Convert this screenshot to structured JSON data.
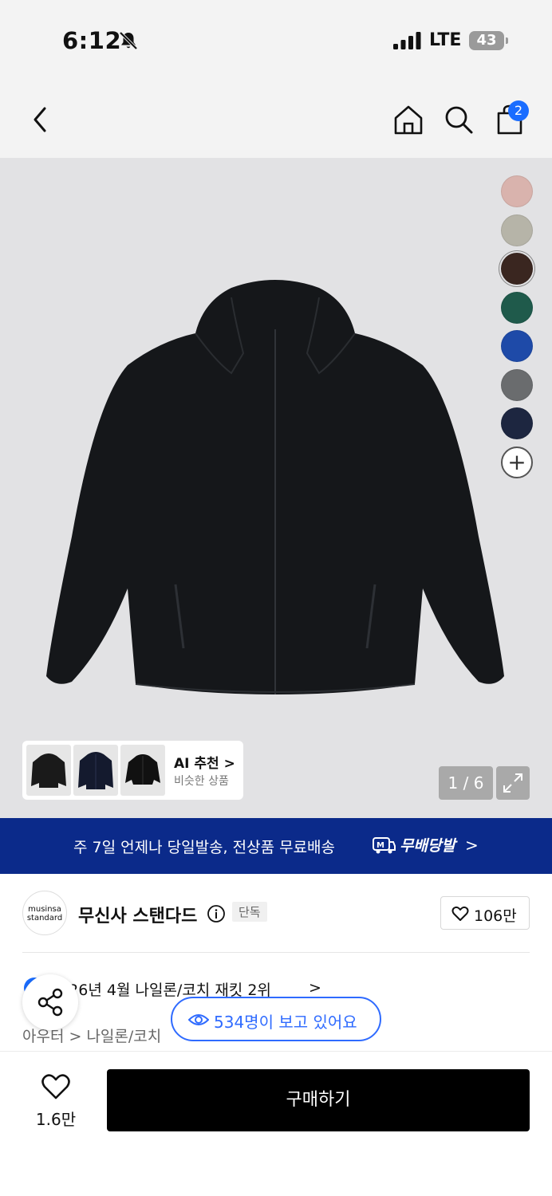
{
  "status_bar": {
    "time": "6:12",
    "network": "LTE",
    "battery": "43"
  },
  "nav": {
    "cart_count": "2"
  },
  "gallery": {
    "swatches": [
      "#d9b3ad",
      "#b6b4a8",
      "#3a2620",
      "#1f5a4b",
      "#1e4aa8",
      "#6a6c6e",
      "#1d2640"
    ],
    "page_indicator": "1 / 6",
    "ai_card": {
      "title": "AI 추천 >",
      "subtitle": "비슷한 상품"
    }
  },
  "banner": {
    "text": "주 7일 언제나 당일발송, 전상품 무료배송",
    "brand": "무배당발",
    "chevron": ">"
  },
  "brand": {
    "logo_line1": "musinsa",
    "logo_line2": "standard",
    "name": "무신사 스탠다드",
    "tag": "단독",
    "likes": "106만"
  },
  "ranking": {
    "text": "2026년 4월 나일론/코치 재킷 2위",
    "chevron": ">"
  },
  "category": {
    "text": "아우터 > 나일론/코치"
  },
  "viewers": {
    "text": "534명이 보고 있어요"
  },
  "bottom": {
    "likes": "1.6만",
    "buy_label": "구매하기"
  }
}
